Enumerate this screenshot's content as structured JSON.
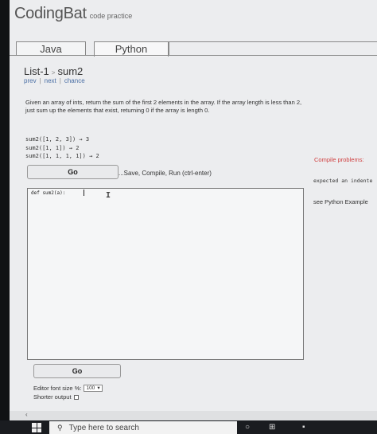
{
  "brand": {
    "name": "CodingBat",
    "tagline": "code practice"
  },
  "tabs": [
    {
      "label": "Java"
    },
    {
      "label": "Python"
    }
  ],
  "breadcrumb": {
    "section": "List-1",
    "separator": ">",
    "problem": "sum2"
  },
  "subnav": {
    "prev": "prev",
    "separator": "|",
    "next": "next",
    "chance": "chance"
  },
  "prompt": "Given an array of ints, return the sum of the first 2 elements in the array. If the array length is less than 2, just sum up the elements that exist, returning 0 if the array is length 0.",
  "examples": [
    "sum2([1, 2, 3]) → 3",
    "sum2([1, 1]) → 2",
    "sum2([1, 1, 1, 1]) → 2"
  ],
  "go_label": "Go",
  "hint": "...Save, Compile, Run (ctrl-enter)",
  "editor": {
    "code": "def sum2(a):"
  },
  "sidebar": {
    "compile_label": "Compile problems:",
    "expected": "expected an indente",
    "see_example": "see Python Example"
  },
  "options": {
    "font_size_label": "Editor font size %:",
    "font_size_value": "100",
    "shorter_output_label": "Shorter output"
  },
  "taskbar": {
    "search_placeholder": "Type here to search"
  }
}
